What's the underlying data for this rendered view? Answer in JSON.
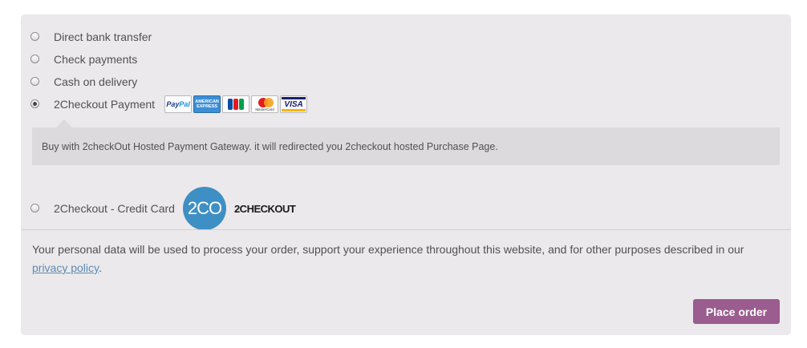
{
  "payment_methods": [
    {
      "label": "Direct bank transfer",
      "selected": false
    },
    {
      "label": "Check payments",
      "selected": false
    },
    {
      "label": "Cash on delivery",
      "selected": false
    },
    {
      "label": "2Checkout Payment",
      "selected": true
    },
    {
      "label": "2Checkout - Credit Card",
      "selected": false
    }
  ],
  "card_logos": {
    "paypal": {
      "pre": "Pay",
      "post": "Pal"
    },
    "amex": {
      "line1": "AMERICAN",
      "line2": "EXPRESS"
    },
    "mastercard": "MasterCard",
    "visa": "VISA"
  },
  "jcb_colors": [
    "#0b4ea2",
    "#e11b22",
    "#009f4a"
  ],
  "payment_box": {
    "description": "Buy with 2checkOut Hosted Payment Gateway. it will redirected you 2checkout hosted Purchase Page."
  },
  "twocheckout_logo": {
    "circle_text": "2CO",
    "brand_text": "2CHECKOUT"
  },
  "privacy": {
    "text_before": "Your personal data will be used to process your order, support your experience throughout this website, and for other purposes described in our ",
    "link_text": "privacy policy",
    "text_after": "."
  },
  "place_order_label": "Place order",
  "colors": {
    "accent": "#9b5c8f",
    "panel": "#ebe9eb",
    "box": "#dcdadc",
    "link": "#5d8ab5"
  }
}
